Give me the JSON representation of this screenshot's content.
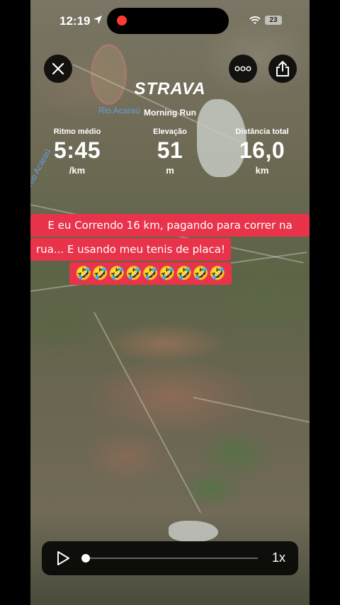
{
  "status_bar": {
    "time": "12:19",
    "battery": "23"
  },
  "app": {
    "logo": "STRAVA",
    "activity_title": "Morning Run"
  },
  "map_labels": {
    "river": "Rio Acaraú",
    "river_side": "Rio Acaraú"
  },
  "stats": [
    {
      "label": "Ritmo médio",
      "value": "5:45",
      "unit": "/km"
    },
    {
      "label": "Elevação",
      "value": "51",
      "unit": "m"
    },
    {
      "label": "Distância total",
      "value": "16,0",
      "unit": "km"
    }
  ],
  "caption": {
    "line1": "E eu Correndo 16 km, pagando para correr na",
    "line2": "rua... E usando meu tenis de placa!",
    "emojis": "🤣🤣🤣🤣🤣🤣🤣🤣🤣"
  },
  "player": {
    "speed": "1x",
    "progress": 0.0
  },
  "colors": {
    "caption_bg": "#e8334a",
    "record_dot": "#ff3b30"
  }
}
